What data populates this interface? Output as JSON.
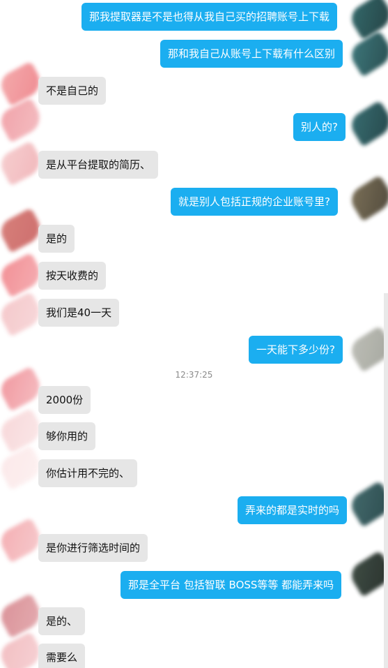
{
  "chat": {
    "timestamp": "12:37:25",
    "messages": [
      {
        "side": "me",
        "text": "那我提取器是不是也得从我自己买的招聘账号上下载"
      },
      {
        "side": "me",
        "text": "那和我自己从账号上下载有什么区别"
      },
      {
        "side": "them",
        "text": "不是自己的"
      },
      {
        "side": "me",
        "text": "别人的?"
      },
      {
        "side": "them",
        "text": "是从平台提取的简历、"
      },
      {
        "side": "me",
        "text": "就是别人包括正规的企业账号里?"
      },
      {
        "side": "them",
        "text": "是的"
      },
      {
        "side": "them",
        "text": "按天收费的"
      },
      {
        "side": "them",
        "text": "我们是40一天"
      },
      {
        "side": "me",
        "text": "一天能下多少份?"
      },
      {
        "side": "them",
        "text": "2000份"
      },
      {
        "side": "them",
        "text": "够你用的"
      },
      {
        "side": "them",
        "text": "你估计用不完的、"
      },
      {
        "side": "me",
        "text": "弄来的都是实时的吗"
      },
      {
        "side": "them",
        "text": "是你进行筛选时间的"
      },
      {
        "side": "me",
        "text": "那是全平台 包括智联 BOSS等等 都能弄来吗"
      },
      {
        "side": "them",
        "text": "是的、"
      },
      {
        "side": "them",
        "text": "需要么"
      }
    ]
  },
  "colors": {
    "outgoing_bubble": "#1baef0",
    "incoming_bubble": "#e6e6e6"
  }
}
